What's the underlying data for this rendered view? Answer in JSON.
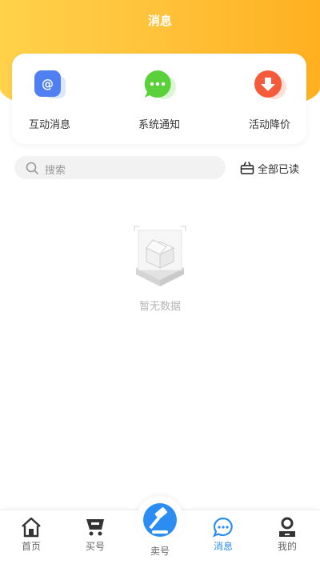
{
  "header": {
    "title": "消息"
  },
  "categories": [
    {
      "label": "互动消息",
      "icon": "at-icon",
      "color": "#4f7ff0"
    },
    {
      "label": "系统通知",
      "icon": "chat-bubble-icon",
      "color": "#5ad13a"
    },
    {
      "label": "活动降价",
      "icon": "down-arrow-icon",
      "color": "#f55a3a"
    }
  ],
  "search": {
    "placeholder": "搜索",
    "mark_all_read": "全部已读"
  },
  "empty_state": {
    "text": "暂无数据"
  },
  "tabbar": {
    "items": [
      {
        "label": "首页",
        "icon": "home-icon"
      },
      {
        "label": "买号",
        "icon": "cart-icon"
      },
      {
        "label": "卖号",
        "icon": "hammer-icon"
      },
      {
        "label": "消息",
        "icon": "message-icon"
      },
      {
        "label": "我的",
        "icon": "user-icon"
      }
    ],
    "active_index": 3,
    "active_color": "#2b8df2"
  }
}
